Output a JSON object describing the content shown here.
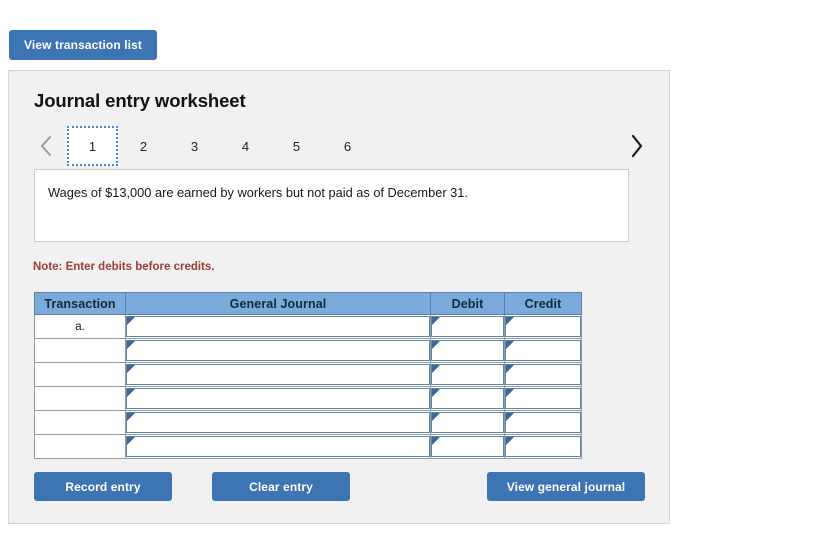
{
  "toolbar": {
    "view_transaction_list_label": "View transaction list"
  },
  "panel": {
    "title": "Journal entry worksheet",
    "pager": {
      "prev_icon": "chevron-left-icon",
      "next_icon": "chevron-right-icon",
      "tabs": [
        {
          "label": "1",
          "active": true
        },
        {
          "label": "2",
          "active": false
        },
        {
          "label": "3",
          "active": false
        },
        {
          "label": "4",
          "active": false
        },
        {
          "label": "5",
          "active": false
        },
        {
          "label": "6",
          "active": false
        }
      ],
      "active_tab": "1"
    },
    "instruction": "Wages of $13,000 are earned by workers but not paid as of December 31.",
    "note": "Note: Enter debits before credits.",
    "table": {
      "headers": [
        "Transaction",
        "General Journal",
        "Debit",
        "Credit"
      ],
      "rows": [
        {
          "transaction": "a.",
          "general_journal": "",
          "debit": "",
          "credit": ""
        },
        {
          "transaction": "",
          "general_journal": "",
          "debit": "",
          "credit": ""
        },
        {
          "transaction": "",
          "general_journal": "",
          "debit": "",
          "credit": ""
        },
        {
          "transaction": "",
          "general_journal": "",
          "debit": "",
          "credit": ""
        },
        {
          "transaction": "",
          "general_journal": "",
          "debit": "",
          "credit": ""
        },
        {
          "transaction": "",
          "general_journal": "",
          "debit": "",
          "credit": ""
        }
      ]
    },
    "actions": {
      "record_entry_label": "Record entry",
      "clear_entry_label": "Clear entry",
      "view_general_journal_label": "View general journal"
    }
  },
  "colors": {
    "button_blue": "#3c74b4",
    "table_header_blue": "#7aabdb",
    "note_red": "#9e3b3b",
    "panel_background": "#f1f1f1",
    "field_border": "#5a86ad",
    "field_marker": "#3f6896"
  }
}
